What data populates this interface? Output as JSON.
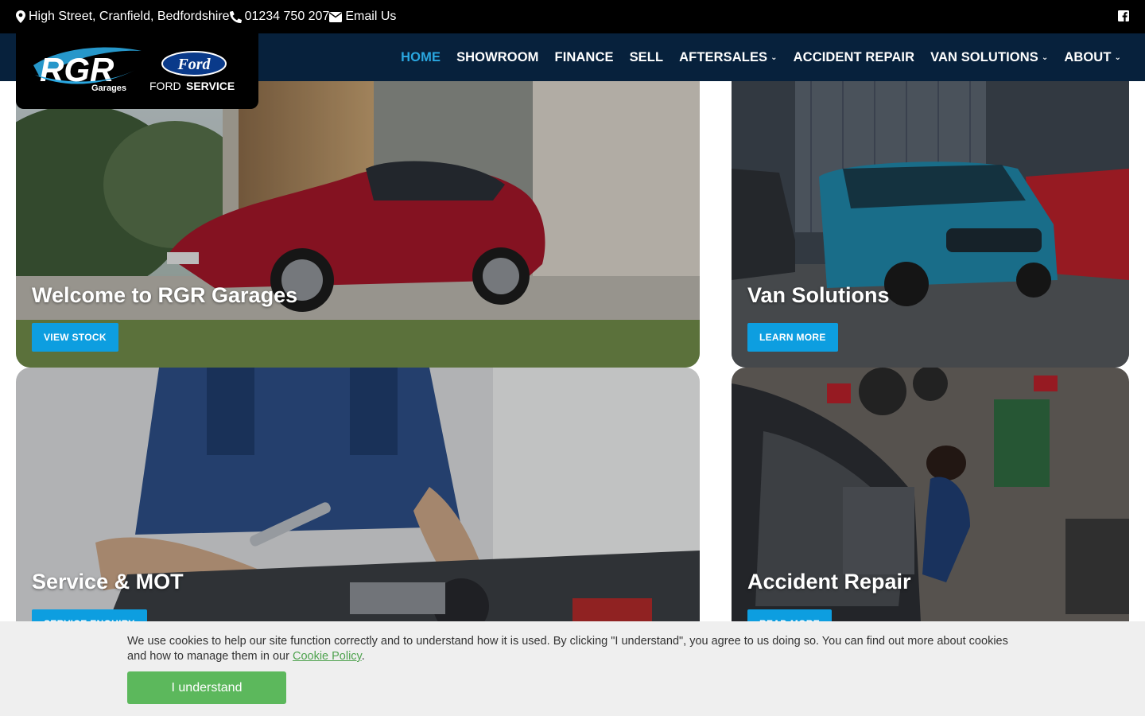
{
  "topbar": {
    "address": "High Street, Cranfield, Bedfordshire",
    "phone": "01234 750 207",
    "email": "Email Us",
    "address_icon": "map-marker-icon",
    "phone_icon": "phone-icon",
    "email_icon": "envelope-icon",
    "social_icon": "facebook-icon"
  },
  "logo": {
    "brand": "RGR",
    "sub": "Garages",
    "partner_badge": "Ford",
    "partner_label_light": "FORD",
    "partner_label_bold": "SERVICE"
  },
  "nav": {
    "items": [
      {
        "label": "HOME",
        "active": true
      },
      {
        "label": "SHOWROOM"
      },
      {
        "label": "FINANCE"
      },
      {
        "label": "SELL"
      },
      {
        "label": "AFTERSALES",
        "dropdown": true
      },
      {
        "label": "ACCIDENT REPAIR"
      },
      {
        "label": "VAN SOLUTIONS",
        "dropdown": true
      },
      {
        "label": "ABOUT",
        "dropdown": true
      }
    ],
    "active_color": "#2aa7e0",
    "bg_color": "#07213c"
  },
  "tiles": [
    {
      "title": "Welcome to RGR Garages",
      "button": "VIEW STOCK"
    },
    {
      "title": "Van Solutions",
      "button": "LEARN MORE"
    },
    {
      "title": "Service & MOT",
      "button": "SERVICE ENQUIRY"
    },
    {
      "title": "Accident Repair",
      "button": "READ MORE"
    }
  ],
  "cookie": {
    "text_before": "We use cookies to help our site function correctly and to understand how it is used. By clicking \"I understand\", you agree to us doing so. You can find out more about cookies and how to manage them in our ",
    "link": "Cookie Policy",
    "text_after": ".",
    "button": "I understand"
  },
  "colors": {
    "button_blue": "#0d9ee0",
    "cookie_button": "#5cb85c"
  }
}
